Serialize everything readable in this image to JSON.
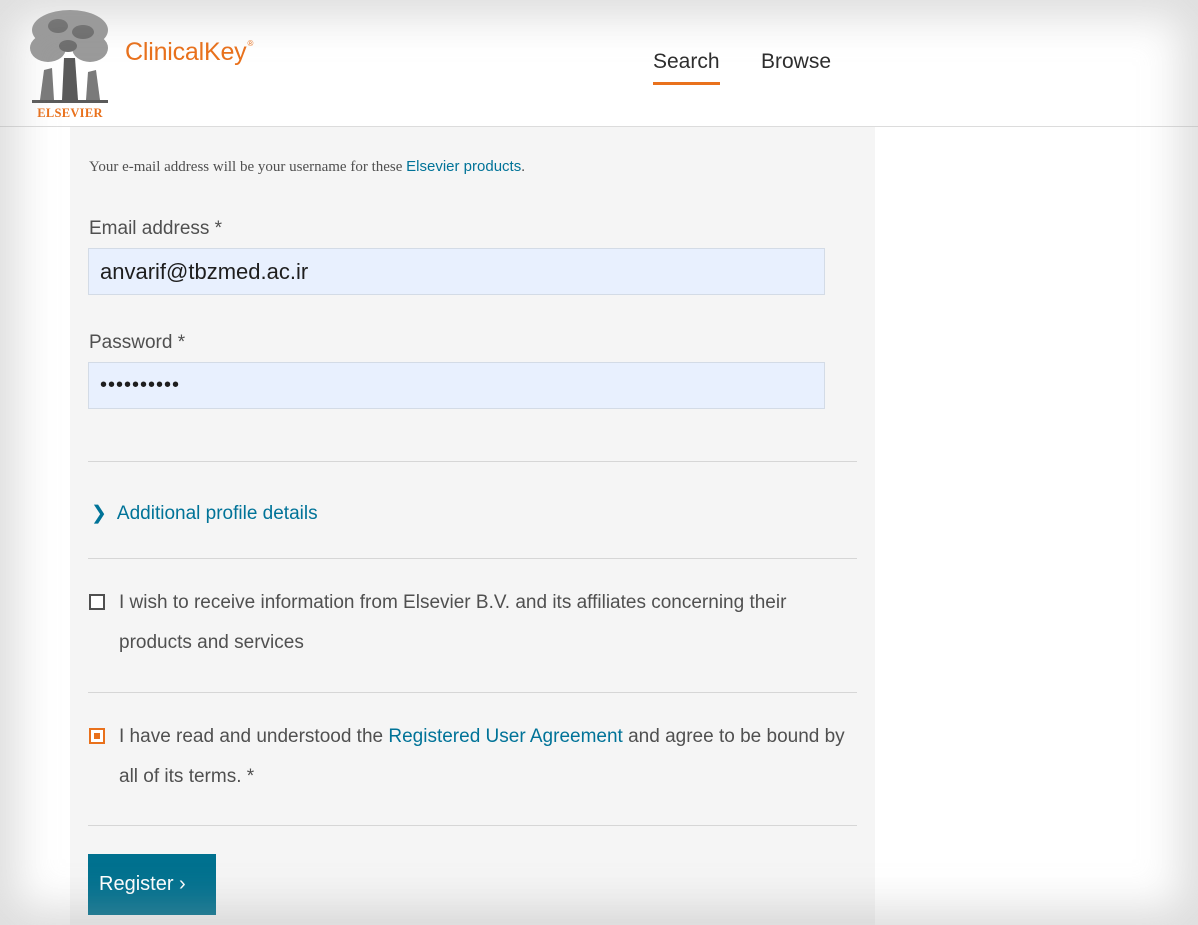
{
  "header": {
    "brand": "ClinicalKey",
    "brand_mark": "®",
    "publisher": "ELSEVIER",
    "nav": {
      "search": "Search",
      "browse": "Browse"
    },
    "accent_color": "#e9711c"
  },
  "form": {
    "intro_prefix": "Your e-mail address will be your username for these ",
    "intro_link": "Elsevier products",
    "intro_suffix": ".",
    "email_label": "Email address *",
    "email_value": "anvarif@tbzmed.ac.ir",
    "password_label": "Password *",
    "password_value": "••••••••••",
    "additional_profile": "Additional profile details",
    "marketing_optin": {
      "checked": false,
      "text": "I wish to receive information from Elsevier B.V. and its affiliates concerning their products and services"
    },
    "agreement": {
      "checked": true,
      "prefix": "I have read and understood the ",
      "link": "Registered User Agreement",
      "suffix": " and agree to be bound by all of its terms. *"
    },
    "register_label": "Register",
    "register_arrow": "›",
    "button_color": "#00718f",
    "link_color": "#007398"
  }
}
